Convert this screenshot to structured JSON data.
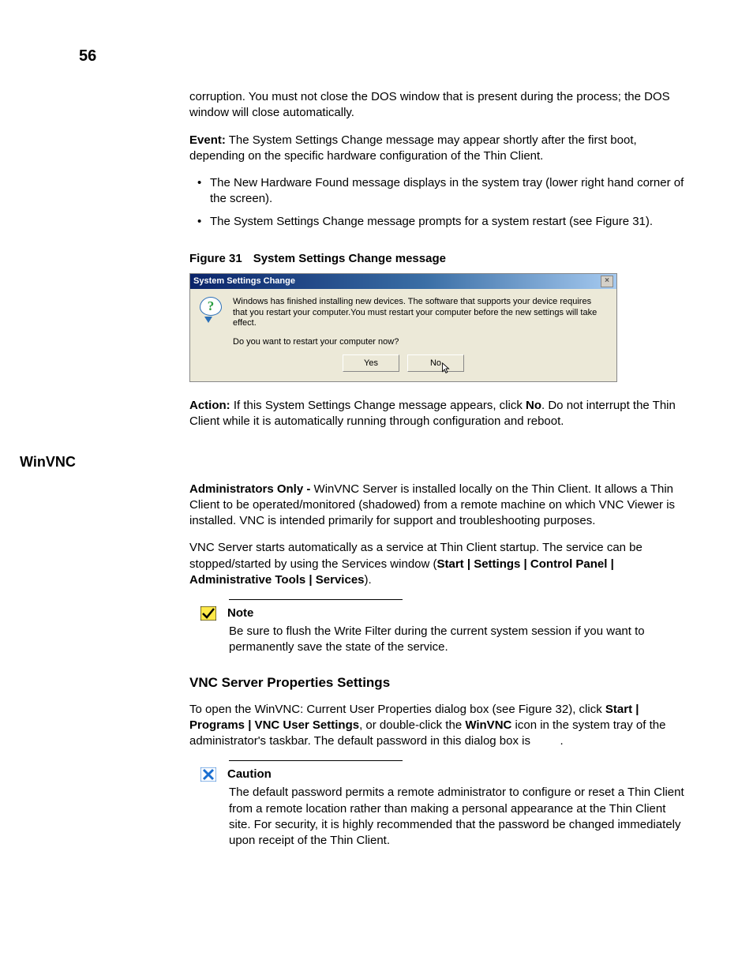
{
  "pageNumber": "56",
  "intro": {
    "corruption": "corruption. You must not close the DOS window that is present during the process; the DOS window will close automatically.",
    "eventLabel": "Event:",
    "eventText": " The System Settings Change message may appear shortly after the first boot, depending on the specific hardware configuration of the Thin Client.",
    "bullets": [
      "The New Hardware Found message displays in the system tray (lower right hand corner of the screen).",
      "The System Settings Change message prompts for a system restart (see Figure 31)."
    ]
  },
  "figure": {
    "num": "Figure 31",
    "title": "System Settings Change message",
    "dialog": {
      "title": "System Settings Change",
      "message": "Windows has finished installing new devices. The software that supports your device requires that you restart your computer.You must restart your computer before the new settings will take effect.",
      "prompt": "Do you want to restart your computer now?",
      "yes": "Yes",
      "no": "No"
    }
  },
  "action": {
    "label": "Action:",
    "text1": " If this System Settings Change message appears, click ",
    "no": "No",
    "text2": ". Do not interrupt the Thin Client while it is automatically running through configuration and reboot."
  },
  "winvnc": {
    "heading": "WinVNC",
    "adminLabel": "Administrators Only - ",
    "adminText": "WinVNC Server is installed locally on the Thin Client. It allows a Thin Client to be operated/monitored (shadowed) from a remote machine on which VNC Viewer is installed. VNC is intended primarily for support and troubleshooting purposes.",
    "vncText1": "VNC Server starts automatically as a service at Thin Client startup. The service can be stopped/started by using the Services window (",
    "vncPath": "Start | Settings | Control Panel | Administrative Tools | Services",
    "vncText2": ")."
  },
  "note": {
    "label": "Note",
    "text": "Be sure to flush the Write Filter during the current system session if you want to permanently save the state of the service."
  },
  "vncProps": {
    "heading": "VNC Server Properties Settings",
    "text1": "To open the WinVNC: Current User Properties dialog box (see Figure 32), click ",
    "path1": "Start | Programs | VNC User Settings",
    "text2": ", or double-click the ",
    "winvnc": "WinVNC",
    "text3": " icon in the system tray of the administrator's taskbar. The default password in this dialog box is ",
    "text4": "."
  },
  "caution": {
    "label": "Caution",
    "text": "The default password permits a remote administrator to configure or reset a Thin Client from a remote location rather than making a personal appearance at the Thin Client site. For security, it is highly recommended that the password be changed immediately upon receipt of the Thin Client."
  }
}
